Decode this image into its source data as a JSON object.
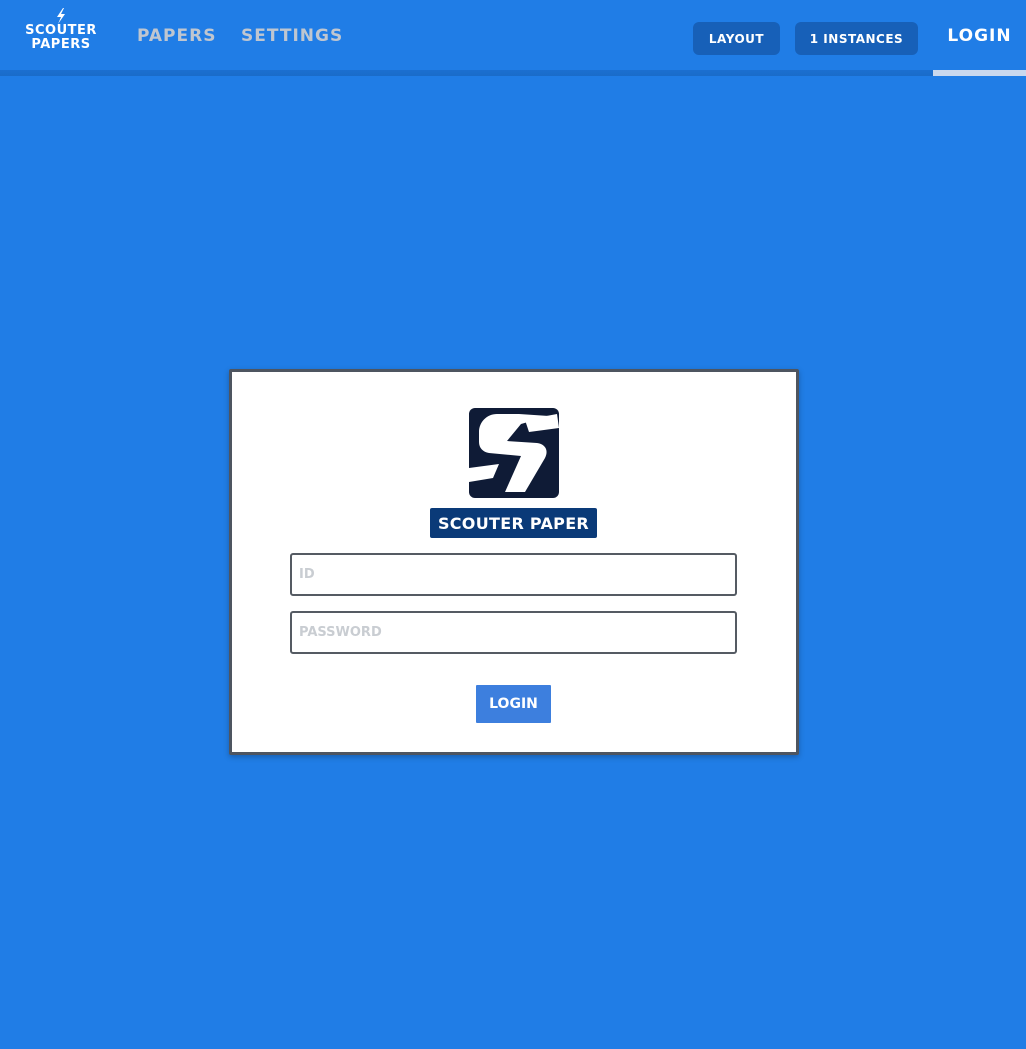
{
  "colors": {
    "background": "#207de6",
    "nav_pill": "#1760b8",
    "nav_link_inactive": "#bfc6d0",
    "card_border": "#4e5560",
    "logo_bg": "#0f1b36",
    "title_badge": "#0a3a78",
    "login_button": "#3d7fde"
  },
  "navbar": {
    "brand": {
      "icon": "lightning-bolt-icon",
      "line1": "SCOUTER",
      "line2": "PAPERS"
    },
    "links": {
      "papers": "PAPERS",
      "settings": "SETTINGS"
    },
    "layout_button": "LAYOUT",
    "instances_button": "1 INSTANCES",
    "login_link": "LOGIN"
  },
  "login_card": {
    "logo_icon": "scouter-lightning-logo",
    "title": "SCOUTER PAPER",
    "id_placeholder": "ID",
    "password_placeholder": "PASSWORD",
    "submit_label": "LOGIN"
  }
}
